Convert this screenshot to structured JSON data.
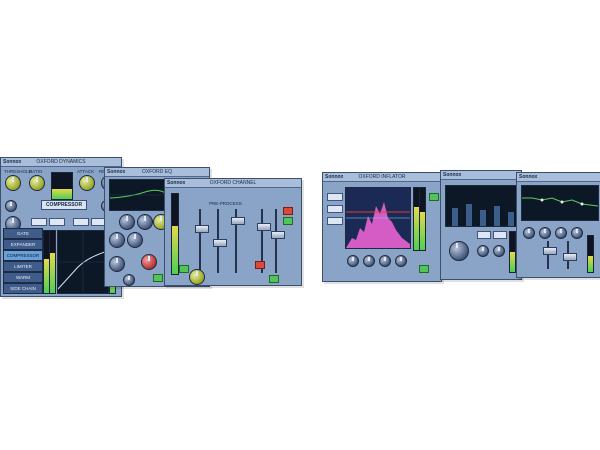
{
  "brand": "Sonnox",
  "panels": {
    "dynamics": {
      "title": "OXFORD DYNAMICS",
      "compressor_label": "COMPRESSOR",
      "section_buttons": [
        "GATE",
        "EXPANDER",
        "COMPRESSOR",
        "LIMITER",
        "WARM",
        "SIDE CHAIN"
      ],
      "knob_labels": [
        "THRESHOLD",
        "RATIO",
        "ATTACK",
        "RELEASE"
      ]
    },
    "eq": {
      "title": "OXFORD EQ"
    },
    "channel": {
      "title": "OXFORD CHANNEL",
      "preprocess_label": "PRE-PROCESS"
    },
    "transmod": {
      "title": "OXFORD INFLATOR"
    },
    "analyser": {
      "title": ""
    },
    "reverb": {
      "title": ""
    },
    "colors": {
      "panel": "#8aa4c8",
      "accent_green": "#54c35a",
      "accent_red": "#d94a3a",
      "screen": "#0d1826"
    }
  }
}
